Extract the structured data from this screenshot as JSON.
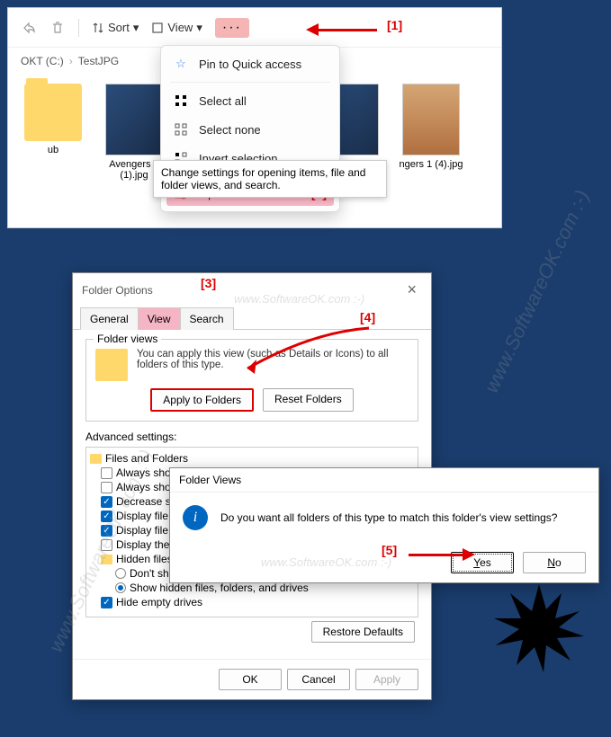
{
  "explorer": {
    "toolbar": {
      "sort_label": "Sort",
      "view_label": "View",
      "ellipsis": "···"
    },
    "breadcrumb": {
      "part1": "OKT (C:)",
      "part2": "TestJPG"
    },
    "files": {
      "folder_name": "ub",
      "file1": "Avengers 1 (1).jpg",
      "file2": ".jpg",
      "file3": "ngers 1 (4).jpg"
    }
  },
  "context_menu": {
    "pin": "Pin to Quick access",
    "select_all": "Select all",
    "select_none": "Select none",
    "invert": "Invert selection",
    "options": "Options"
  },
  "tooltip": "Change settings for opening items, file and folder views, and search.",
  "labels": {
    "l1": "[1]",
    "l2": "[2]",
    "l3": "[3]",
    "l4": "[4]",
    "l5": "[5]"
  },
  "dialog": {
    "title": "Folder Options",
    "tab_general": "General",
    "tab_view": "View",
    "tab_search": "Search",
    "folder_views_legend": "Folder views",
    "folder_views_text": "You can apply this view (such as Details or Icons) to all folders of this type.",
    "apply_folders": "Apply to Folders",
    "reset_folders": "Reset Folders",
    "advanced_label": "Advanced settings:",
    "tree": {
      "root": "Files and Folders",
      "i1": "Always show",
      "i2": "Always show",
      "i3": "Decrease spa",
      "i4": "Display file ico",
      "i5": "Display file size",
      "i6": "Display the full path in the title bar",
      "i7": "Hidden files and folders",
      "i7a": "Don't show hidden files, folders, or drives",
      "i7b": "Show hidden files, folders, and drives",
      "i8": "Hide empty drives"
    },
    "restore": "Restore Defaults",
    "ok": "OK",
    "cancel": "Cancel",
    "apply": "Apply"
  },
  "confirm": {
    "title": "Folder Views",
    "text": "Do you want all folders of this type to match this folder's view settings?",
    "yes": "Yes",
    "no": "No"
  },
  "watermark": "www.SoftwareOK.com :-)"
}
